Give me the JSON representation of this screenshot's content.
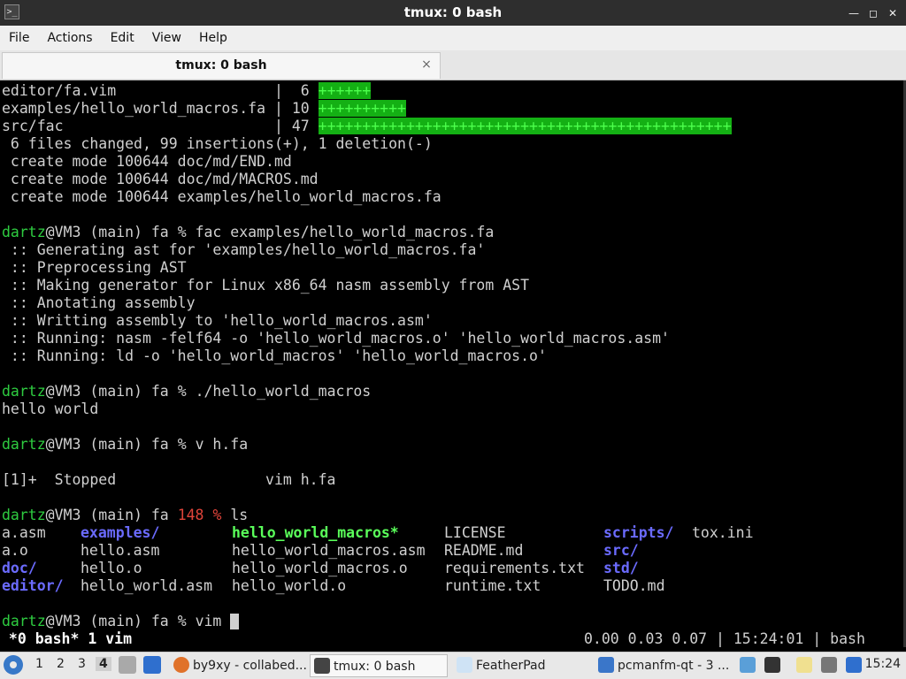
{
  "window": {
    "title": "tmux: 0 bash",
    "menu": [
      "File",
      "Actions",
      "Edit",
      "View",
      "Help"
    ],
    "tab": {
      "label": "tmux: 0 bash",
      "close_symbol": "×"
    }
  },
  "terminal": {
    "diffstat": [
      {
        "path": "editor/fa.vim                  ",
        "sep": "|",
        "count": "  6",
        "bar": "++++++"
      },
      {
        "path": "examples/hello_world_macros.fa ",
        "sep": "|",
        "count": " 10",
        "bar": "++++++++++"
      },
      {
        "path": "src/fac                        ",
        "sep": "|",
        "count": " 47",
        "bar": "+++++++++++++++++++++++++++++++++++++++++++++++"
      }
    ],
    "summary": " 6 files changed, 99 insertions(+), 1 deletion(-)",
    "creates": [
      " create mode 100644 doc/md/END.md",
      " create mode 100644 doc/md/MACROS.md",
      " create mode 100644 examples/hello_world_macros.fa"
    ],
    "prompt_user": "dartz",
    "prompt_host": "@VM3 (main) fa ",
    "prompt_symbol": "% ",
    "cmd1": "fac examples/hello_world_macros.fa",
    "compile_output": [
      " :: Generating ast for 'examples/hello_world_macros.fa'",
      " :: Preprocessing AST",
      " :: Making generator for Linux x86_64 nasm assembly from AST",
      " :: Anotating assembly",
      " :: Writting assembly to 'hello_world_macros.asm'",
      " :: Running: nasm -felf64 -o 'hello_world_macros.o' 'hello_world_macros.asm'",
      " :: Running: ld -o 'hello_world_macros' 'hello_world_macros.o'"
    ],
    "cmd2": "./hello_world_macros",
    "output2": "hello world",
    "cmd3": "v h.fa",
    "job_line": "[1]+  Stopped                 vim h.fa",
    "exit_status": "148 ",
    "cmd4": "ls",
    "ls": [
      [
        {
          "t": "a.asm",
          "c": ""
        },
        {
          "t": "examples/",
          "c": "b"
        },
        {
          "t": "hello_world_macros*",
          "c": "gb"
        },
        {
          "t": "LICENSE",
          "c": ""
        },
        {
          "t": "scripts/",
          "c": "b"
        },
        {
          "t": "tox.ini",
          "c": ""
        }
      ],
      [
        {
          "t": "a.o",
          "c": ""
        },
        {
          "t": "hello.asm",
          "c": ""
        },
        {
          "t": "hello_world_macros.asm",
          "c": ""
        },
        {
          "t": "README.md",
          "c": ""
        },
        {
          "t": "src/",
          "c": "b"
        },
        {
          "t": "",
          "c": ""
        }
      ],
      [
        {
          "t": "doc/",
          "c": "b"
        },
        {
          "t": "hello.o",
          "c": ""
        },
        {
          "t": "hello_world_macros.o",
          "c": ""
        },
        {
          "t": "requirements.txt",
          "c": ""
        },
        {
          "t": "std/",
          "c": "b"
        },
        {
          "t": "",
          "c": ""
        }
      ],
      [
        {
          "t": "editor/",
          "c": "b"
        },
        {
          "t": "hello_world.asm",
          "c": ""
        },
        {
          "t": "hello_world.o",
          "c": ""
        },
        {
          "t": "runtime.txt",
          "c": ""
        },
        {
          "t": "TODO.md",
          "c": ""
        },
        {
          "t": "",
          "c": ""
        }
      ]
    ],
    "cmd5": "vim "
  },
  "tmux_status": {
    "windows": " *0 bash* 1 vim",
    "right": "0.00 0.03 0.07 | 15:24:01 | bash"
  },
  "taskbar": {
    "workspaces": [
      "1",
      "2",
      "3",
      "4"
    ],
    "active_workspace": "4",
    "tasks": [
      "by9xy - collabed...",
      "tmux: 0 bash",
      "FeatherPad",
      "pcmanfm-qt - 3 ..."
    ],
    "clock": "15:24"
  },
  "colors": {
    "prompt_user": "#2ecc40",
    "directory": "#6b6bff",
    "executable": "#5aff5a",
    "diff_bar": "#14b014",
    "error_status": "#e0443a"
  }
}
